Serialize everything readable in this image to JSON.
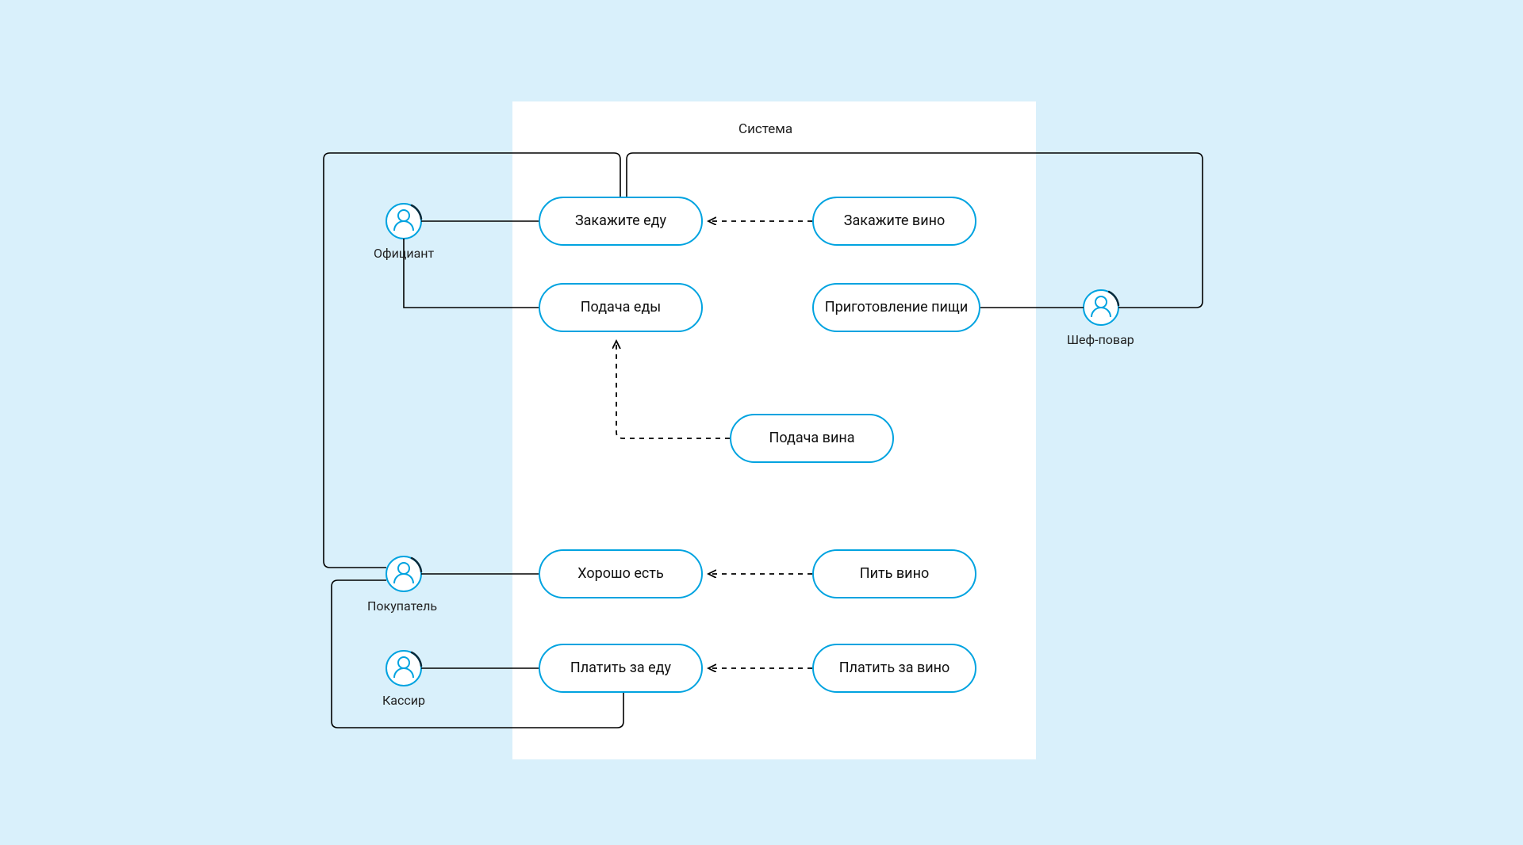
{
  "diagram": {
    "system_title": "Система",
    "actors": {
      "waiter": "Официант",
      "customer": "Покупатель",
      "cashier": "Кассир",
      "chef": "Шеф-повар"
    },
    "usecases": {
      "order_food": "Закажите еду",
      "order_wine": "Закажите вино",
      "serve_food": "Подача еды",
      "cook_food": "Приготовление пищи",
      "serve_wine": "Подача вина",
      "eat_food": "Хорошо есть",
      "drink_wine": "Пить вино",
      "pay_food": "Платить за еду",
      "pay_wine": "Платить за вино"
    },
    "connections": [
      {
        "from": "waiter",
        "to": "order_food",
        "style": "solid"
      },
      {
        "from": "waiter",
        "to": "serve_food",
        "style": "solid"
      },
      {
        "from": "waiter",
        "to": "eat_food",
        "style": "solid",
        "note": "routing bus"
      },
      {
        "from": "customer",
        "to": "eat_food",
        "style": "solid"
      },
      {
        "from": "customer",
        "to": "pay_food",
        "style": "solid"
      },
      {
        "from": "cashier",
        "to": "pay_food",
        "style": "solid"
      },
      {
        "from": "chef",
        "to": "order_food",
        "style": "solid",
        "note": "via top bus"
      },
      {
        "from": "chef",
        "to": "cook_food",
        "style": "solid"
      },
      {
        "from": "order_wine",
        "to": "order_food",
        "style": "dashed-arrow"
      },
      {
        "from": "serve_wine",
        "to": "serve_food",
        "style": "dashed-arrow"
      },
      {
        "from": "drink_wine",
        "to": "eat_food",
        "style": "dashed-arrow"
      },
      {
        "from": "pay_wine",
        "to": "pay_food",
        "style": "dashed-arrow"
      }
    ]
  }
}
